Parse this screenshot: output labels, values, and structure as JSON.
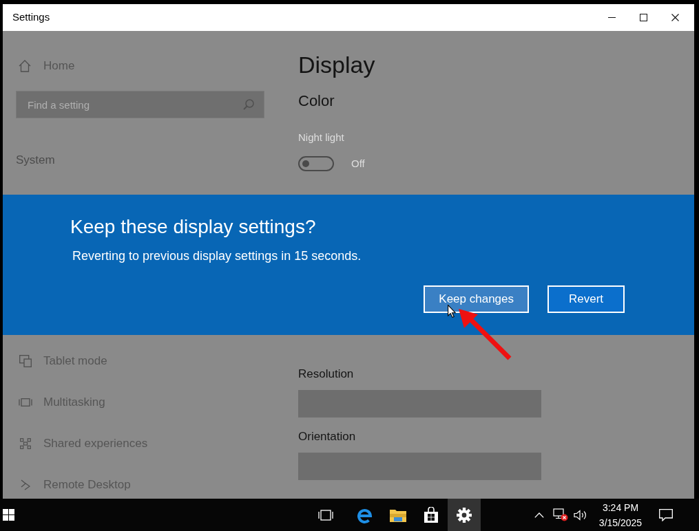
{
  "window": {
    "title": "Settings"
  },
  "sidebar": {
    "home": {
      "label": "Home"
    },
    "search": {
      "placeholder": "Find a setting"
    },
    "section": "System",
    "items": [
      {
        "label": "Tablet mode",
        "kind": "tablet"
      },
      {
        "label": "Multitasking",
        "kind": "multitasking"
      },
      {
        "label": "Shared experiences",
        "kind": "sharing"
      },
      {
        "label": "Remote Desktop",
        "kind": "remote"
      }
    ]
  },
  "main": {
    "title": "Display",
    "section": "Color",
    "night_light": {
      "label": "Night light",
      "on": false,
      "state_text": "Off"
    },
    "dropdowns": [
      {
        "label": "Resolution"
      },
      {
        "label": "Orientation"
      }
    ]
  },
  "dialog": {
    "title": "Keep these display settings?",
    "message": "Reverting to previous display settings in 15 seconds.",
    "buttons": [
      {
        "label": "Keep changes",
        "hovered": true
      },
      {
        "label": "Revert",
        "hovered": false
      }
    ]
  },
  "taskbar": {
    "apps": [
      {
        "kind": "taskview",
        "active": false
      },
      {
        "kind": "edge",
        "active": false
      },
      {
        "kind": "explorer",
        "active": false
      },
      {
        "kind": "store",
        "active": false
      },
      {
        "kind": "settings",
        "active": true
      }
    ],
    "clock": {
      "time": "3:24 PM",
      "date": "3/15/2025"
    }
  }
}
